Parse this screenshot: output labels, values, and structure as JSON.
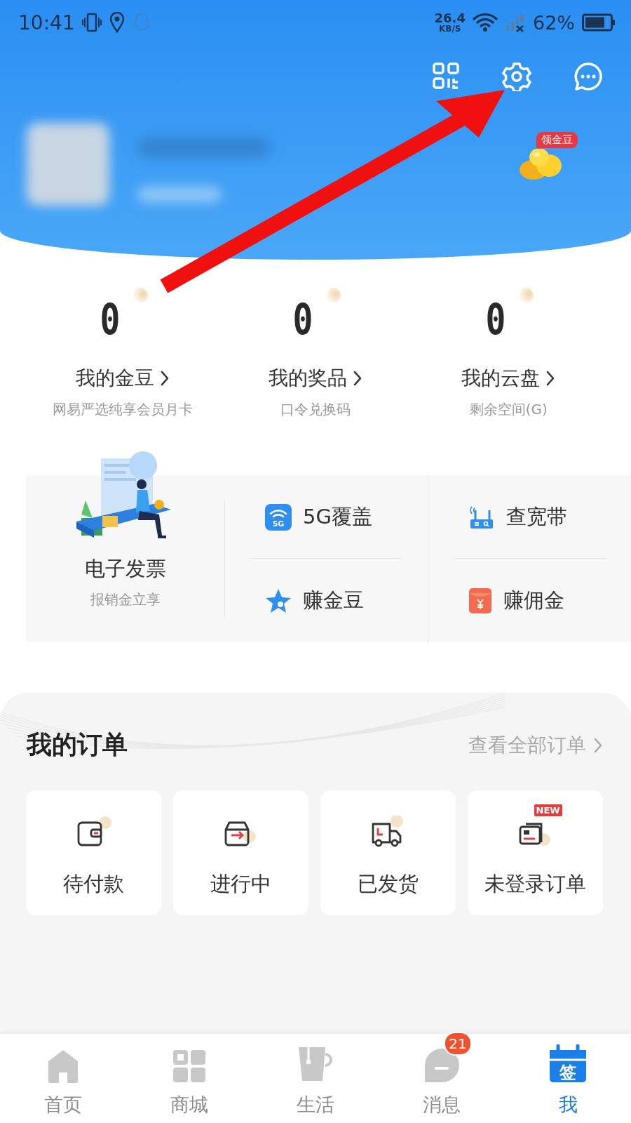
{
  "status_bar": {
    "time": "10:41",
    "net_speed": "26.4",
    "net_unit": "KB/S",
    "battery": "62%"
  },
  "header": {
    "badge": "领金豆"
  },
  "stats": [
    {
      "value": "0",
      "label": "我的金豆",
      "sub": "网易严选纯享会员月卡"
    },
    {
      "value": "0",
      "label": "我的奖品",
      "sub": "口令兑换码"
    },
    {
      "value": "0",
      "label": "我的云盘",
      "sub": "剩余空间(G)"
    }
  ],
  "services": {
    "feature": {
      "title": "电子发票",
      "subtitle": "报销金立享"
    },
    "items": [
      {
        "label": "5G覆盖",
        "kind": "coverage",
        "icon_text": "5G"
      },
      {
        "label": "查宽带",
        "kind": "broadband"
      },
      {
        "label": "赚金豆",
        "kind": "star"
      },
      {
        "label": "赚佣金",
        "kind": "envelope"
      }
    ]
  },
  "orders": {
    "title": "我的订单",
    "link": "查看全部订单",
    "items": [
      {
        "label": "待付款",
        "kind": "wallet"
      },
      {
        "label": "进行中",
        "kind": "box"
      },
      {
        "label": "已发货",
        "kind": "truck"
      },
      {
        "label": "未登录订单",
        "kind": "card",
        "badge": "NEW"
      }
    ]
  },
  "tab_bar": [
    {
      "label": "首页",
      "kind": "home",
      "selected": false
    },
    {
      "label": "商城",
      "kind": "shop",
      "selected": false
    },
    {
      "label": "生活",
      "kind": "life",
      "selected": false
    },
    {
      "label": "消息",
      "kind": "message",
      "selected": false,
      "badge": "21"
    },
    {
      "label": "我",
      "kind": "me",
      "selected": true,
      "icon_text": "签"
    }
  ],
  "annotation": {
    "kind": "arrow"
  }
}
